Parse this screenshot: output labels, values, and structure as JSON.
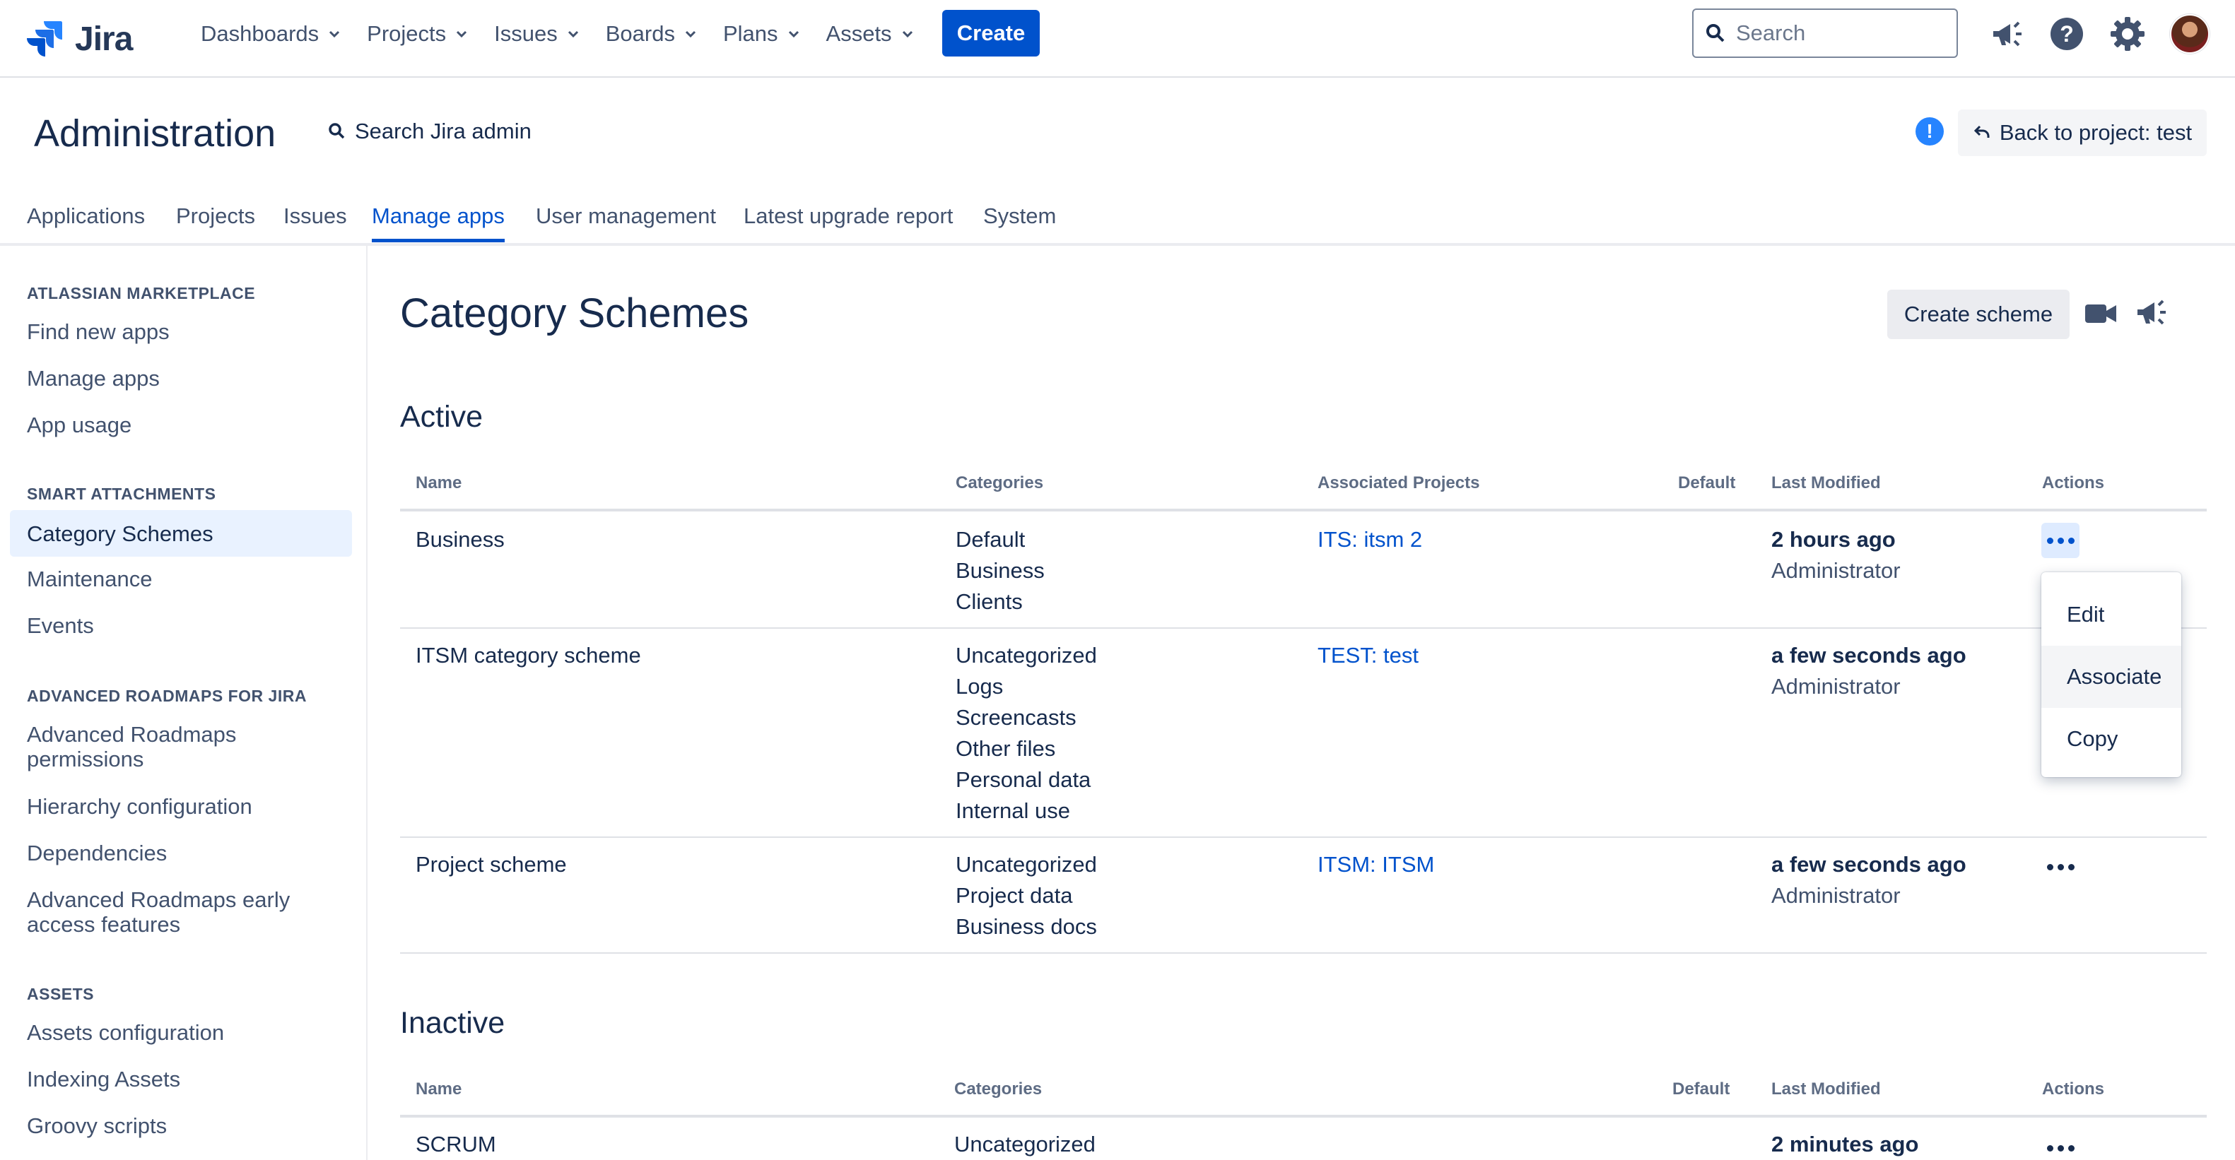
{
  "app": {
    "name": "Jira"
  },
  "topnav": {
    "items": [
      {
        "label": "Dashboards"
      },
      {
        "label": "Projects"
      },
      {
        "label": "Issues"
      },
      {
        "label": "Boards"
      },
      {
        "label": "Plans"
      },
      {
        "label": "Assets"
      }
    ],
    "create_label": "Create",
    "search_placeholder": "Search",
    "icons": [
      "megaphone-icon",
      "help-icon",
      "settings-icon",
      "avatar"
    ]
  },
  "admin": {
    "title": "Administration",
    "search_label": "Search Jira admin",
    "back_label": "Back to project: test",
    "info_badge": "!"
  },
  "admin_tabs": [
    {
      "label": "Applications"
    },
    {
      "label": "Projects"
    },
    {
      "label": "Issues"
    },
    {
      "label": "Manage apps",
      "active": true
    },
    {
      "label": "User management"
    },
    {
      "label": "Latest upgrade report"
    },
    {
      "label": "System"
    }
  ],
  "sidebar": {
    "sections": [
      {
        "heading": "ATLASSIAN MARKETPLACE",
        "items": [
          "Find new apps",
          "Manage apps",
          "App usage"
        ]
      },
      {
        "heading": "SMART ATTACHMENTS",
        "items": [
          "Category Schemes",
          "Maintenance",
          "Events"
        ]
      },
      {
        "heading": "ADVANCED ROADMAPS FOR JIRA",
        "items": [
          "Advanced Roadmaps permissions",
          "Hierarchy configuration",
          "Dependencies",
          "Advanced Roadmaps early access features"
        ]
      },
      {
        "heading": "ASSETS",
        "items": [
          "Assets configuration",
          "Indexing Assets",
          "Groovy scripts"
        ]
      }
    ],
    "selected": "Category Schemes"
  },
  "main": {
    "title": "Category Schemes",
    "create_scheme_label": "Create scheme",
    "active": {
      "title": "Active",
      "columns": [
        "Name",
        "Categories",
        "Associated Projects",
        "Default",
        "Last Modified",
        "Actions"
      ],
      "rows": [
        {
          "name": "Business",
          "categories": [
            "Default",
            "Business",
            "Clients"
          ],
          "project": "ITS: itsm 2",
          "default": "",
          "modified": "2 hours ago",
          "modified_by": "Administrator"
        },
        {
          "name": "ITSM category scheme",
          "categories": [
            "Uncategorized",
            "Logs",
            "Screencasts",
            "Other files",
            "Personal data",
            "Internal use"
          ],
          "project": "TEST: test",
          "default": "",
          "modified": "a few seconds ago",
          "modified_by": "Administrator"
        },
        {
          "name": "Project scheme",
          "categories": [
            "Uncategorized",
            "Project data",
            "Business docs"
          ],
          "project": "ITSM: ITSM",
          "default": "",
          "modified": "a few seconds ago",
          "modified_by": "Administrator"
        }
      ]
    },
    "inactive": {
      "title": "Inactive",
      "columns": [
        "Name",
        "Categories",
        "Default",
        "Last Modified",
        "Actions"
      ],
      "rows": [
        {
          "name": "SCRUM",
          "categories": [
            "Uncategorized"
          ],
          "modified": "2 minutes ago"
        }
      ]
    },
    "actions_menu": {
      "items": [
        "Edit",
        "Associate",
        "Copy"
      ],
      "hovered": "Associate"
    }
  },
  "colors": {
    "primary": "#0052cc",
    "text": "#172b4d",
    "muted": "#42526e",
    "selected_bg": "#e9f2ff"
  }
}
